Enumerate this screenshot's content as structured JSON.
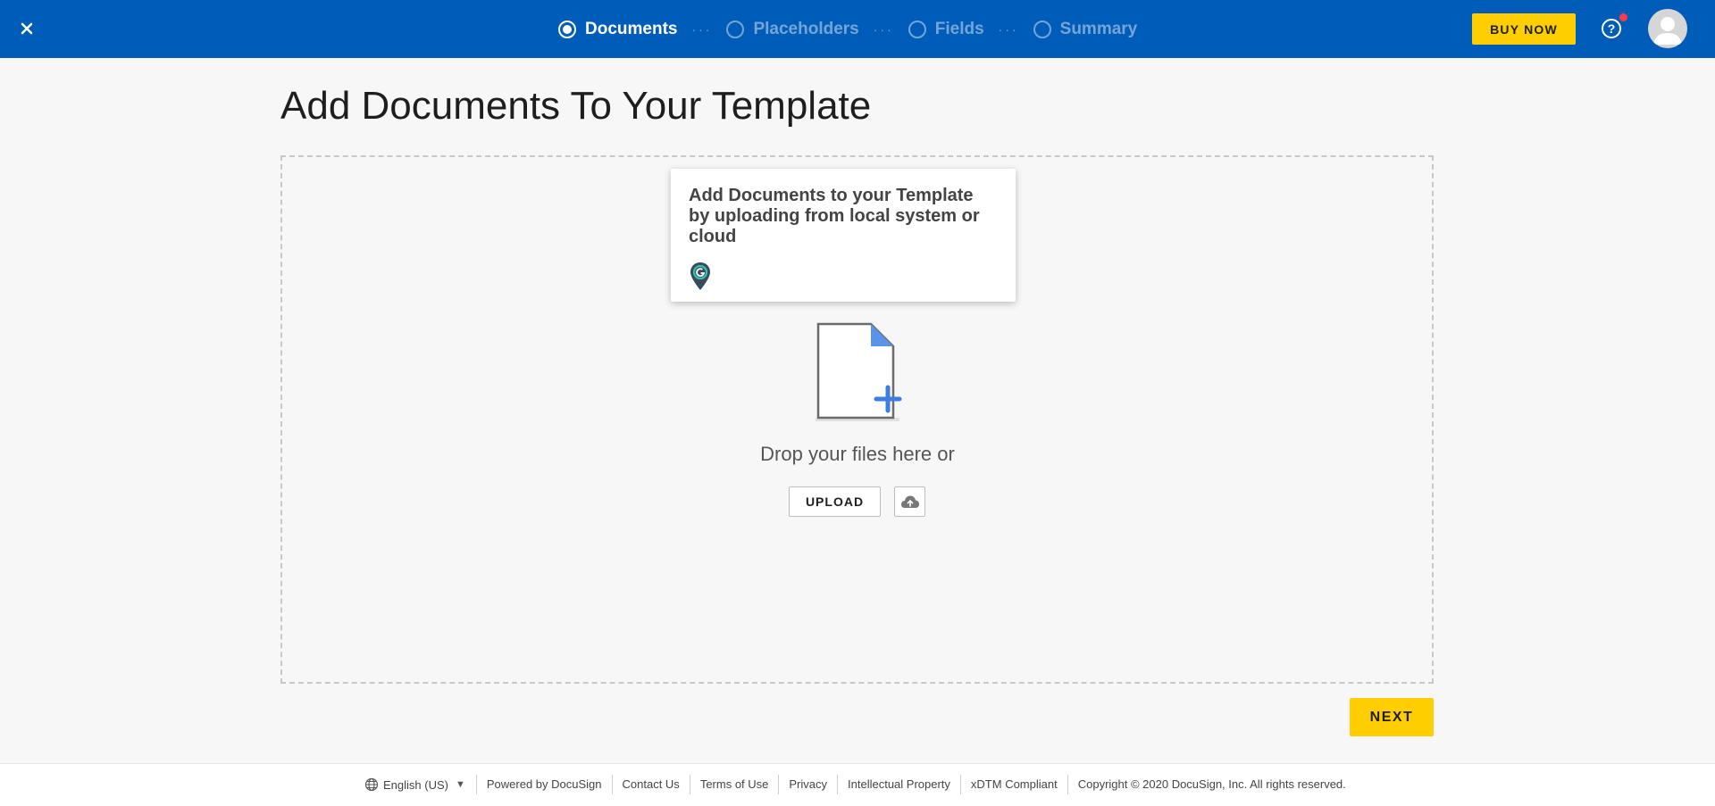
{
  "header": {
    "close_icon": "close-icon",
    "steps": [
      {
        "label": "Documents",
        "state": "active"
      },
      {
        "label": "Placeholders",
        "state": "inactive"
      },
      {
        "label": "Fields",
        "state": "inactive"
      },
      {
        "label": "Summary",
        "state": "inactive"
      }
    ],
    "buy_now_label": "BUY NOW",
    "help_label": "?",
    "notification_color": "#ff3b4a",
    "brand_color": "#005cb9",
    "accent_color": "#ffce00"
  },
  "main": {
    "title": "Add Documents To Your Template",
    "tooltip": {
      "text": "Add Documents to your Template by uploading from local system or cloud",
      "icon": "guide-pin-icon"
    },
    "drop_text": "Drop your files here or",
    "upload_label": "UPLOAD",
    "cloud_icon": "cloud-upload-icon",
    "next_label": "NEXT"
  },
  "footer": {
    "language": "English (US)",
    "links": [
      "Powered by DocuSign",
      "Contact Us",
      "Terms of Use",
      "Privacy",
      "Intellectual Property",
      "xDTM Compliant"
    ],
    "copyright": "Copyright © 2020 DocuSign, Inc. All rights reserved."
  }
}
